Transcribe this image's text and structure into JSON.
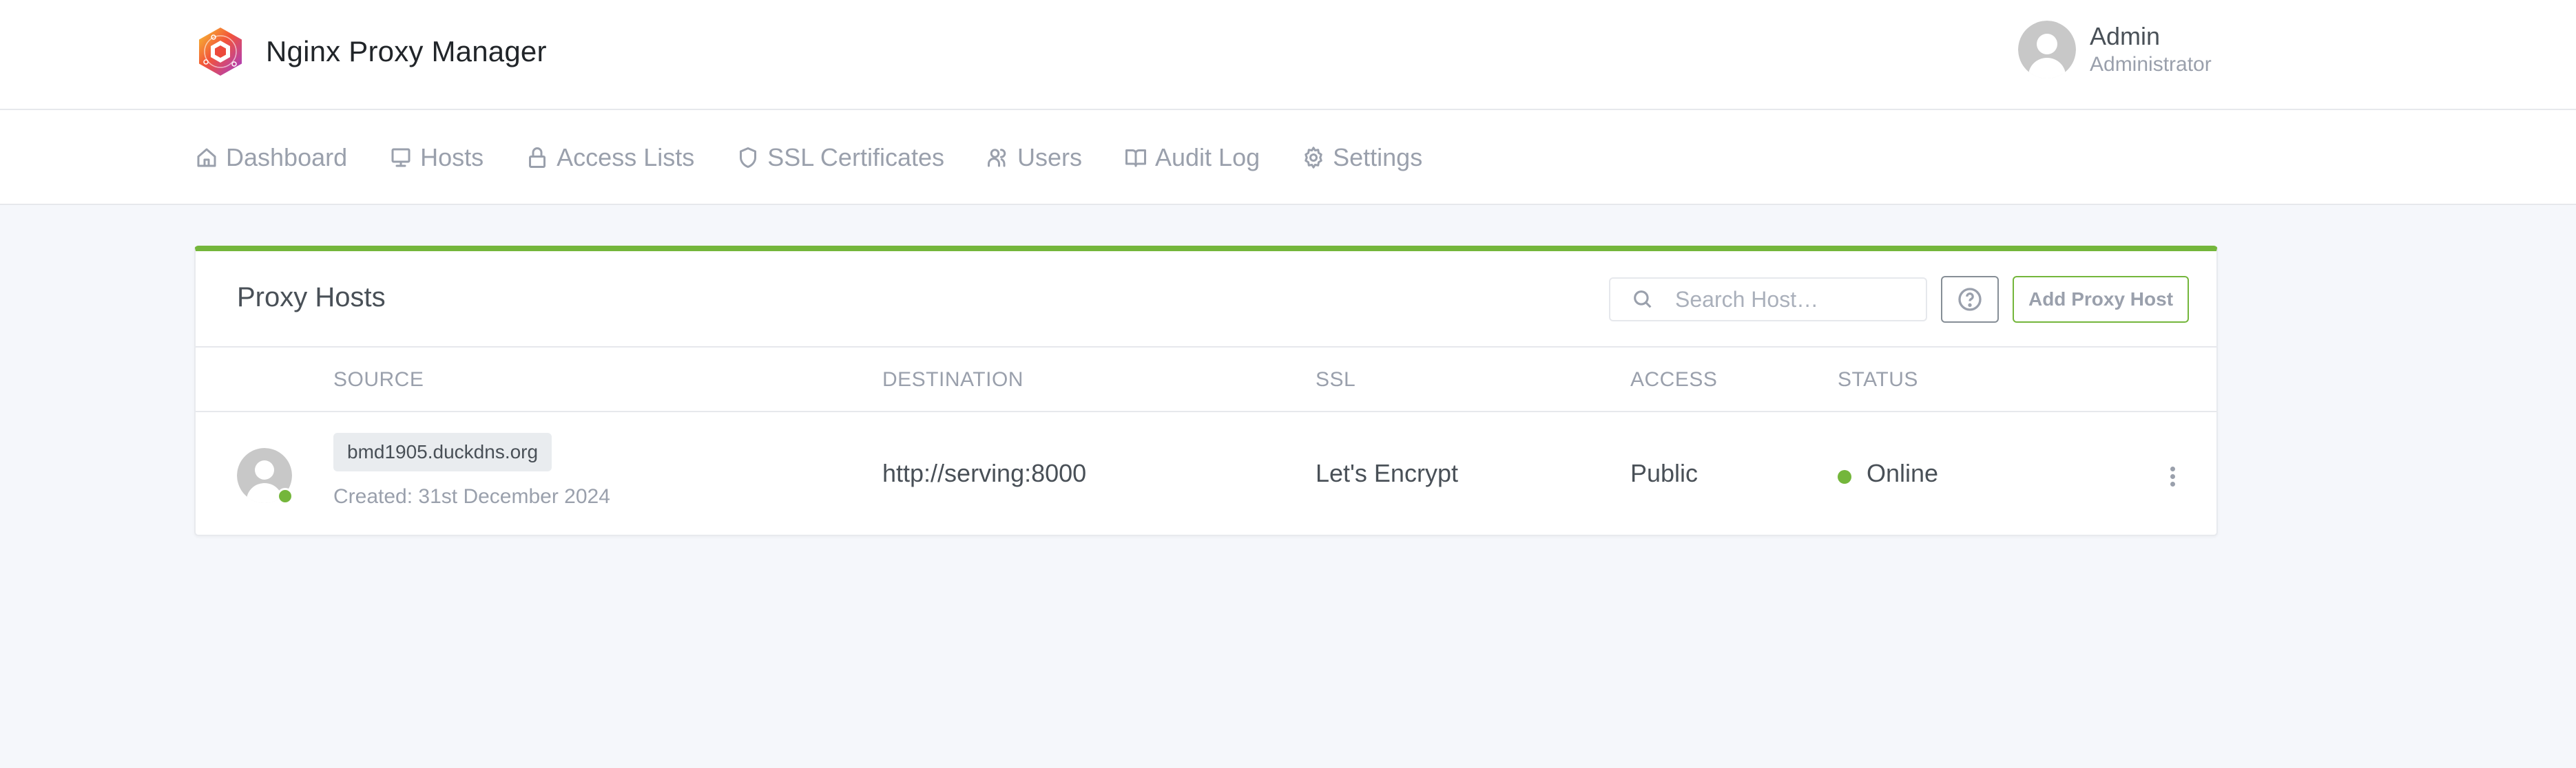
{
  "app": {
    "title": "Nginx Proxy Manager"
  },
  "user": {
    "name": "Admin",
    "role": "Administrator"
  },
  "nav": {
    "items": [
      {
        "label": "Dashboard",
        "icon": "home-icon"
      },
      {
        "label": "Hosts",
        "icon": "monitor-icon"
      },
      {
        "label": "Access Lists",
        "icon": "lock-icon"
      },
      {
        "label": "SSL Certificates",
        "icon": "shield-icon"
      },
      {
        "label": "Users",
        "icon": "users-icon"
      },
      {
        "label": "Audit Log",
        "icon": "book-open-icon"
      },
      {
        "label": "Settings",
        "icon": "gear-icon"
      }
    ]
  },
  "card": {
    "title": "Proxy Hosts",
    "accent_color": "#74b63b",
    "search": {
      "placeholder": "Search Host…",
      "value": ""
    },
    "help_icon": "help-circle-icon",
    "add_button_label": "Add Proxy Host"
  },
  "table": {
    "columns": [
      "SOURCE",
      "DESTINATION",
      "SSL",
      "ACCESS",
      "STATUS"
    ],
    "rows": [
      {
        "source": "bmd1905.duckdns.org",
        "created": "Created: 31st December 2024",
        "destination": "http://serving:8000",
        "ssl": "Let's Encrypt",
        "access": "Public",
        "status": "Online",
        "status_color": "#74b63b"
      }
    ]
  }
}
